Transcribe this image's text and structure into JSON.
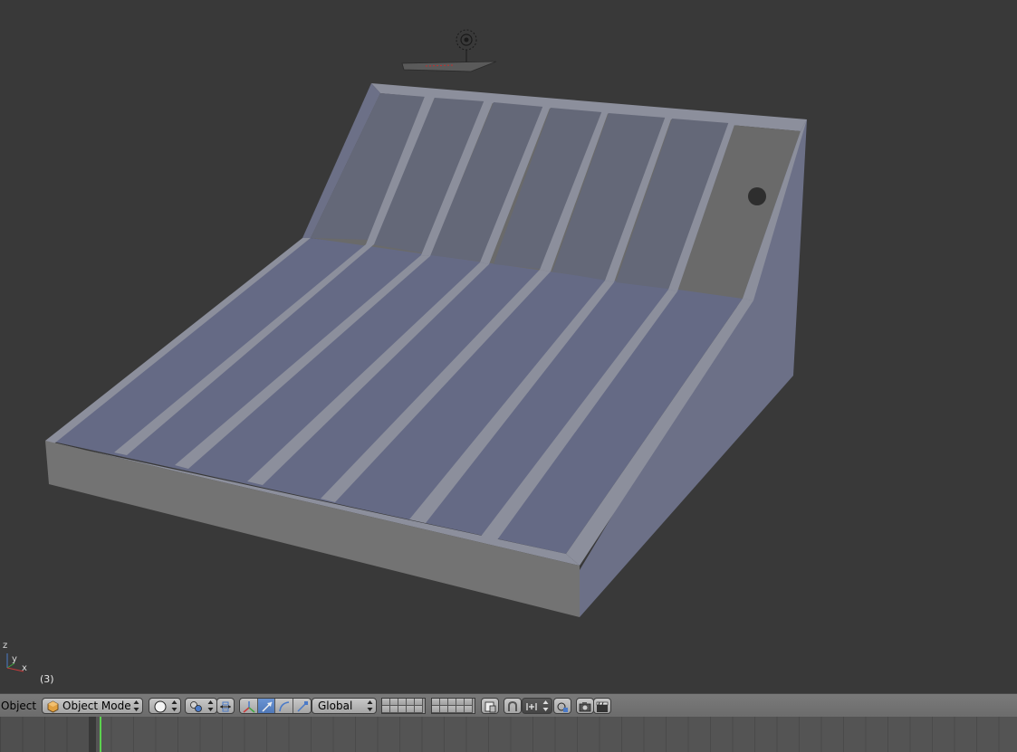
{
  "viewport": {
    "frame_indicator": "(3)",
    "axis_labels": {
      "z": "z",
      "y": "y",
      "x": "x"
    },
    "colors": {
      "background": "#393939",
      "model_surface": "#6c7087",
      "model_edges": "#8c8f9c",
      "model_front": "#737373"
    }
  },
  "header": {
    "menu_object_label": "Object",
    "mode_select": {
      "value": "Object Mode",
      "icon": "cube-icon"
    },
    "viewport_shading": {
      "icon": "sphere-shading-icon"
    },
    "pivot_point": {
      "icon": "pivot-icon"
    },
    "manipulator_toggle": {
      "icon": "manipulator-axes-icon"
    },
    "manipulators": [
      {
        "name": "translate",
        "icon": "arrow-translate-icon",
        "active": true
      },
      {
        "name": "rotate",
        "icon": "arc-rotate-icon",
        "active": false
      },
      {
        "name": "scale",
        "icon": "scale-icon",
        "active": false
      }
    ],
    "transform_orientation": {
      "value": "Global"
    },
    "layers": {
      "icon": "layer-grid-icon"
    },
    "snap_tools": [
      {
        "icon": "layer-manager-icon"
      },
      {
        "icon": "magnet-icon"
      },
      {
        "icon": "snap-element-icon"
      },
      {
        "icon": "render-camera-icon"
      },
      {
        "icon": "clapperboard-icon"
      }
    ]
  },
  "timeline": {
    "current_frame_marker": "playhead",
    "playhead_color": "#5cd24f"
  }
}
